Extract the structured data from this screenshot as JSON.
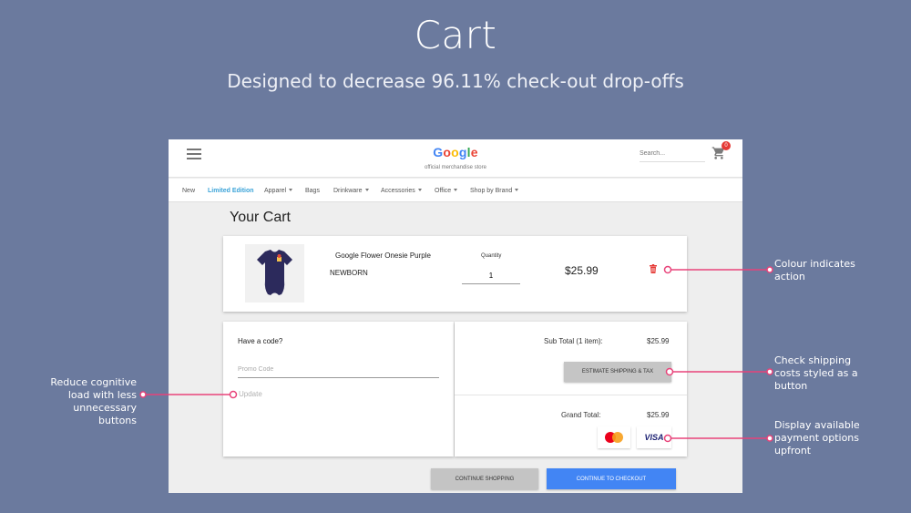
{
  "slide": {
    "title": "Cart",
    "subtitle": "Designed to decrease 96.11%  check-out drop-offs"
  },
  "header": {
    "logo_letters": [
      "G",
      "o",
      "o",
      "g",
      "l",
      "e"
    ],
    "logo_sub": "official merchandise store",
    "search_placeholder": "Search...",
    "cart_count": "0"
  },
  "nav": {
    "items": [
      {
        "label": "New",
        "dropdown": false
      },
      {
        "label": "Limited Edition",
        "dropdown": false,
        "active": true
      },
      {
        "label": "Apparel",
        "dropdown": true
      },
      {
        "label": "Bags",
        "dropdown": false
      },
      {
        "label": "Drinkware",
        "dropdown": true
      },
      {
        "label": "Accessories",
        "dropdown": true
      },
      {
        "label": "Office",
        "dropdown": true
      },
      {
        "label": "Shop by Brand",
        "dropdown": true
      }
    ]
  },
  "cart": {
    "title": "Your Cart",
    "item": {
      "name": "Google Flower Onesie Purple",
      "size": "NEWBORN",
      "quantity_label": "Quantity",
      "quantity": "1",
      "price": "$25.99"
    },
    "promo": {
      "label": "Have a code?",
      "placeholder": "Promo Code",
      "update": "Update"
    },
    "totals": {
      "subtotal_label": "Sub Total (1 item):",
      "subtotal_value": "$25.99",
      "estimate_button": "ESTIMATE SHIPPING & TAX",
      "grand_label": "Grand Total:",
      "grand_value": "$25.99",
      "payments": [
        "mastercard",
        "VISA"
      ]
    },
    "continue_shopping": "CONTINUE SHOPPING",
    "checkout": "CONTINUE TO CHECKOUT"
  },
  "annotations": {
    "colour_action": [
      "Colour indicates",
      "action"
    ],
    "shipping_button": [
      "Check shipping",
      "costs styled as a",
      "button"
    ],
    "payment_options": [
      "Display available",
      "payment options",
      "upfront"
    ],
    "cognitive_load": [
      "Reduce cognitive",
      "load  with less",
      "unnecessary",
      "buttons"
    ]
  },
  "colors": {
    "background": "#6b7a9e",
    "accent_blue": "#4285f4",
    "nav_active": "#3aa3d8",
    "delete_red": "#e53935",
    "callout_pink": "#e8437a"
  }
}
